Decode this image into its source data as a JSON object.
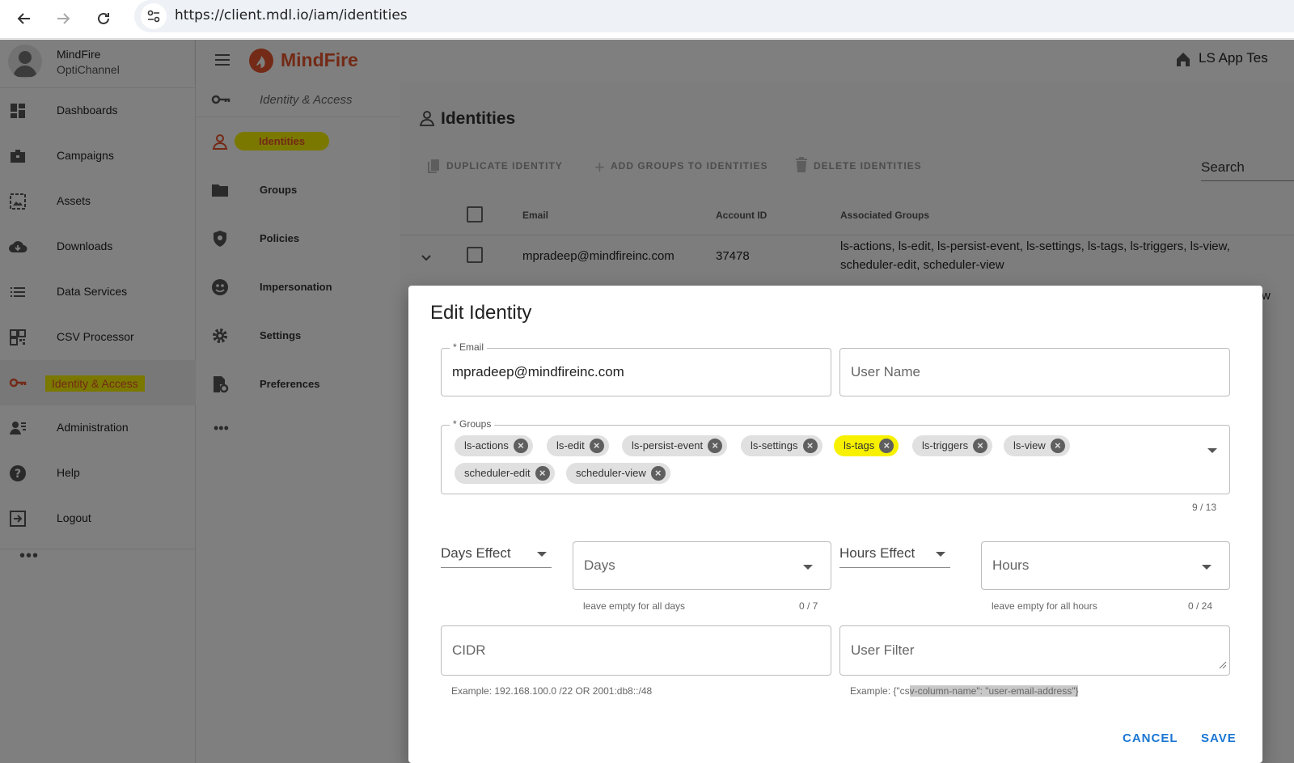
{
  "browser": {
    "url": "https://client.mdl.io/iam/identities"
  },
  "profile": {
    "org_name": "MindFire",
    "org_sub": "OptiChannel"
  },
  "brand": {
    "logo_text": "MindFire",
    "accent": "#e6542c",
    "highlight": "#f7f100",
    "link_blue": "#1976d2"
  },
  "leftnav": {
    "items": [
      {
        "label": "Dashboards",
        "icon": "dashboard-icon"
      },
      {
        "label": "Campaigns",
        "icon": "briefcase-icon"
      },
      {
        "label": "Assets",
        "icon": "assets-icon"
      },
      {
        "label": "Downloads",
        "icon": "cloud-download-icon"
      },
      {
        "label": "Data Services",
        "icon": "list-icon"
      },
      {
        "label": "CSV Processor",
        "icon": "qr-grid-icon"
      },
      {
        "label": "Identity & Access",
        "icon": "key-icon"
      },
      {
        "label": "Administration",
        "icon": "admin-icon"
      },
      {
        "label": "Help",
        "icon": "help-icon"
      },
      {
        "label": "Logout",
        "icon": "logout-icon"
      }
    ],
    "more": "•••"
  },
  "topbar": {
    "right_text": "LS App Tes"
  },
  "subnav": {
    "header": "Identity & Access",
    "items": [
      {
        "label": "Identities"
      },
      {
        "label": "Groups"
      },
      {
        "label": "Policies"
      },
      {
        "label": "Impersonation"
      },
      {
        "label": "Settings"
      },
      {
        "label": "Preferences"
      }
    ],
    "more": "•••"
  },
  "main": {
    "title": "Identities",
    "toolbar": {
      "duplicate": "DUPLICATE IDENTITY",
      "add_groups": "ADD GROUPS TO IDENTITIES",
      "delete": "DELETE IDENTITIES"
    },
    "search_placeholder": "Search",
    "table": {
      "headers": [
        "Email",
        "Account ID",
        "Associated Groups"
      ],
      "rows": [
        {
          "email": "mpradeep@mindfireinc.com",
          "account_id": "37478",
          "groups_line1": "ls-actions, ls-edit, ls-persist-event, ls-settings, ls-tags, ls-triggers, ls-view,",
          "groups_line2": "scheduler-edit, scheduler-view"
        }
      ],
      "partial_cell": "w"
    }
  },
  "dialog": {
    "title": "Edit Identity",
    "email": {
      "label": "* Email",
      "value": "mpradeep@mindfireinc.com"
    },
    "username": {
      "placeholder": "User Name"
    },
    "groups": {
      "label": "* Groups",
      "chips": [
        "ls-actions",
        "ls-edit",
        "ls-persist-event",
        "ls-settings",
        "ls-tags",
        "ls-triggers",
        "ls-view",
        "scheduler-edit",
        "scheduler-view"
      ],
      "counter": "9 / 13"
    },
    "days_effect": "Days Effect",
    "days": {
      "placeholder": "Days",
      "helper": "leave empty for all days",
      "counter": "0 / 7"
    },
    "hours_effect": "Hours Effect",
    "hours": {
      "placeholder": "Hours",
      "helper": "leave empty for all hours",
      "counter": "0 / 24"
    },
    "cidr": {
      "placeholder": "CIDR",
      "helper": "Example: 192.168.100.0 /22 OR 2001:db8::/48"
    },
    "user_filter": {
      "placeholder": "User Filter",
      "helper_prefix": "Example: {\"cs",
      "helper_highlight": "v-column-name\": \"user-email-address\"}"
    },
    "cancel": "CANCEL",
    "save": "SAVE"
  }
}
